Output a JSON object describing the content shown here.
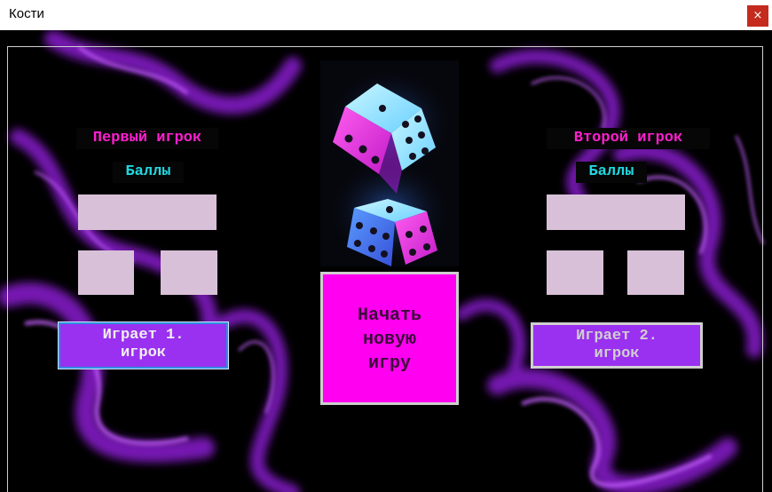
{
  "window": {
    "title": "Кости",
    "close_glyph": "×"
  },
  "player1": {
    "name": "Первый игрок",
    "points_label": "Баллы",
    "total_value": "",
    "die1_value": "",
    "die2_value": "",
    "turn_label_line1": "Играет 1.",
    "turn_label_line2": "игрок"
  },
  "player2": {
    "name": "Второй игрок",
    "points_label": "Баллы",
    "total_value": "",
    "die1_value": "",
    "die2_value": "",
    "turn_label_line1": "Играет 2.",
    "turn_label_line2": "игрок"
  },
  "new_game": {
    "line1": "Начать",
    "line2": "новую",
    "line3": "игру"
  },
  "colors": {
    "accent_pink": "#ff1fcf",
    "accent_cyan": "#20d8e0",
    "button_purple": "#9a30f0",
    "new_game_magenta": "#ff00f0",
    "value_box": "#d8c0d8"
  }
}
